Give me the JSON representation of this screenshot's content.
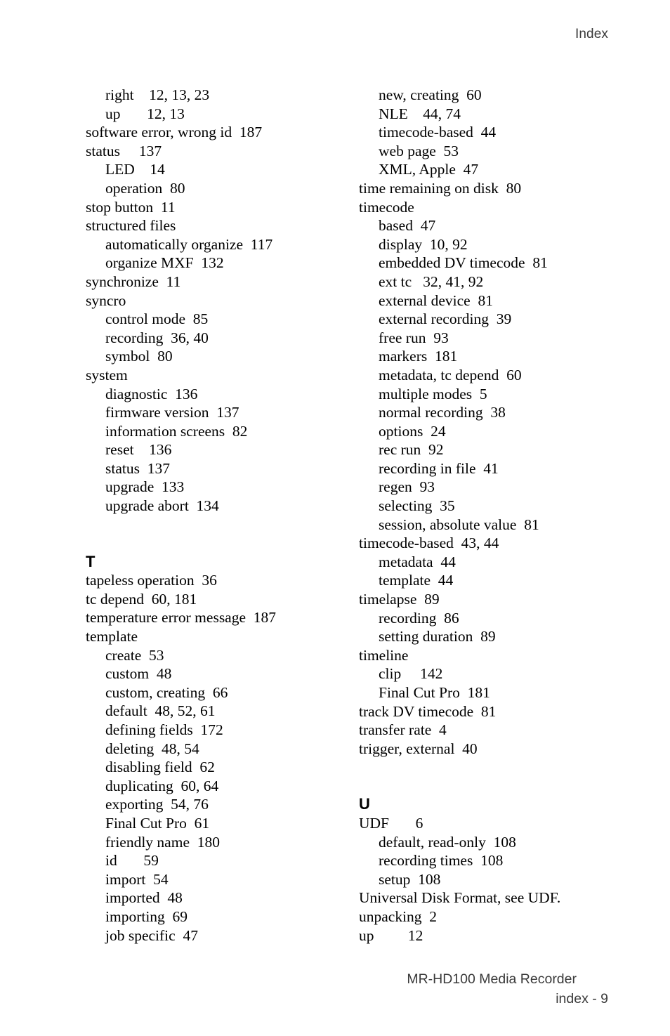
{
  "header": {
    "title": "Index"
  },
  "footer": {
    "document_title": "MR-HD100 Media Recorder",
    "page_label": "index - 9"
  },
  "left_column": {
    "blocks": [
      {
        "type": "entries",
        "entries": [
          {
            "level": 2,
            "text": "right    12, 13, 23"
          },
          {
            "level": 2,
            "text": "up       12, 13"
          },
          {
            "level": 1,
            "text": "software error, wrong id  187"
          },
          {
            "level": 1,
            "text": "status     137"
          },
          {
            "level": 2,
            "text": "LED    14"
          },
          {
            "level": 2,
            "text": "operation  80"
          },
          {
            "level": 1,
            "text": "stop button  11"
          },
          {
            "level": 1,
            "text": "structured files"
          },
          {
            "level": 2,
            "text": "automatically organize  117"
          },
          {
            "level": 2,
            "text": "organize MXF  132"
          },
          {
            "level": 1,
            "text": "synchronize  11"
          },
          {
            "level": 1,
            "text": "syncro"
          },
          {
            "level": 2,
            "text": "control mode  85"
          },
          {
            "level": 2,
            "text": "recording  36, 40"
          },
          {
            "level": 2,
            "text": "symbol  80"
          },
          {
            "level": 1,
            "text": "system"
          },
          {
            "level": 2,
            "text": "diagnostic  136"
          },
          {
            "level": 2,
            "text": "firmware version  137"
          },
          {
            "level": 2,
            "text": "information screens  82"
          },
          {
            "level": 2,
            "text": "reset    136"
          },
          {
            "level": 2,
            "text": "status  137"
          },
          {
            "level": 2,
            "text": "upgrade  133"
          },
          {
            "level": 2,
            "text": "upgrade abort  134"
          }
        ]
      },
      {
        "type": "gap"
      },
      {
        "type": "heading",
        "letter": "T"
      },
      {
        "type": "entries",
        "entries": [
          {
            "level": 1,
            "text": "tapeless operation  36"
          },
          {
            "level": 1,
            "text": "tc depend  60, 181"
          },
          {
            "level": 1,
            "text": "temperature error message  187"
          },
          {
            "level": 1,
            "text": "template"
          },
          {
            "level": 2,
            "text": "create  53"
          },
          {
            "level": 2,
            "text": "custom  48"
          },
          {
            "level": 2,
            "text": "custom, creating  66"
          },
          {
            "level": 2,
            "text": "default  48, 52, 61"
          },
          {
            "level": 2,
            "text": "defining fields  172"
          },
          {
            "level": 2,
            "text": "deleting  48, 54"
          },
          {
            "level": 2,
            "text": "disabling field  62"
          },
          {
            "level": 2,
            "text": "duplicating  60, 64"
          },
          {
            "level": 2,
            "text": "exporting  54, 76"
          },
          {
            "level": 2,
            "text": "Final Cut Pro  61"
          },
          {
            "level": 2,
            "text": "friendly name  180"
          },
          {
            "level": 2,
            "text": "id       59"
          },
          {
            "level": 2,
            "text": "import  54"
          },
          {
            "level": 2,
            "text": "imported  48"
          },
          {
            "level": 2,
            "text": "importing  69"
          },
          {
            "level": 2,
            "text": "job specific  47"
          }
        ]
      }
    ]
  },
  "right_column": {
    "blocks": [
      {
        "type": "entries",
        "entries": [
          {
            "level": 2,
            "text": "new, creating  60"
          },
          {
            "level": 2,
            "text": "NLE    44, 74"
          },
          {
            "level": 2,
            "text": "timecode-based  44"
          },
          {
            "level": 2,
            "text": "web page  53"
          },
          {
            "level": 2,
            "text": "XML, Apple  47"
          },
          {
            "level": 1,
            "text": "time remaining on disk  80"
          },
          {
            "level": 1,
            "text": "timecode"
          },
          {
            "level": 2,
            "text": "based  47"
          },
          {
            "level": 2,
            "text": "display  10, 92"
          },
          {
            "level": 2,
            "text": "embedded DV timecode  81"
          },
          {
            "level": 2,
            "text": "ext tc   32, 41, 92"
          },
          {
            "level": 2,
            "text": "external device  81"
          },
          {
            "level": 2,
            "text": "external recording  39"
          },
          {
            "level": 2,
            "text": "free run  93"
          },
          {
            "level": 2,
            "text": "markers  181"
          },
          {
            "level": 2,
            "text": "metadata, tc depend  60"
          },
          {
            "level": 2,
            "text": "multiple modes  5"
          },
          {
            "level": 2,
            "text": "normal recording  38"
          },
          {
            "level": 2,
            "text": "options  24"
          },
          {
            "level": 2,
            "text": "rec run  92"
          },
          {
            "level": 2,
            "text": "recording in file  41"
          },
          {
            "level": 2,
            "text": "regen  93"
          },
          {
            "level": 2,
            "text": "selecting  35"
          },
          {
            "level": 2,
            "text": "session, absolute value  81"
          },
          {
            "level": 1,
            "text": "timecode-based  43, 44"
          },
          {
            "level": 2,
            "text": "metadata  44"
          },
          {
            "level": 2,
            "text": "template  44"
          },
          {
            "level": 1,
            "text": "timelapse  89"
          },
          {
            "level": 2,
            "text": "recording  86"
          },
          {
            "level": 2,
            "text": "setting duration  89"
          },
          {
            "level": 1,
            "text": "timeline"
          },
          {
            "level": 2,
            "text": "clip     142"
          },
          {
            "level": 2,
            "text": "Final Cut Pro  181"
          },
          {
            "level": 1,
            "text": "track DV timecode  81"
          },
          {
            "level": 1,
            "text": "transfer rate  4"
          },
          {
            "level": 1,
            "text": "trigger, external  40"
          }
        ]
      },
      {
        "type": "gap"
      },
      {
        "type": "heading",
        "letter": "U"
      },
      {
        "type": "entries",
        "entries": [
          {
            "level": 1,
            "text": "UDF       6"
          },
          {
            "level": 2,
            "text": "default, read-only  108"
          },
          {
            "level": 2,
            "text": "recording times  108"
          },
          {
            "level": 2,
            "text": "setup  108"
          },
          {
            "level": 1,
            "text": "Universal Disk Format, see UDF."
          },
          {
            "level": 1,
            "text": "unpacking  2"
          },
          {
            "level": 1,
            "text": "up         12"
          }
        ]
      }
    ]
  }
}
